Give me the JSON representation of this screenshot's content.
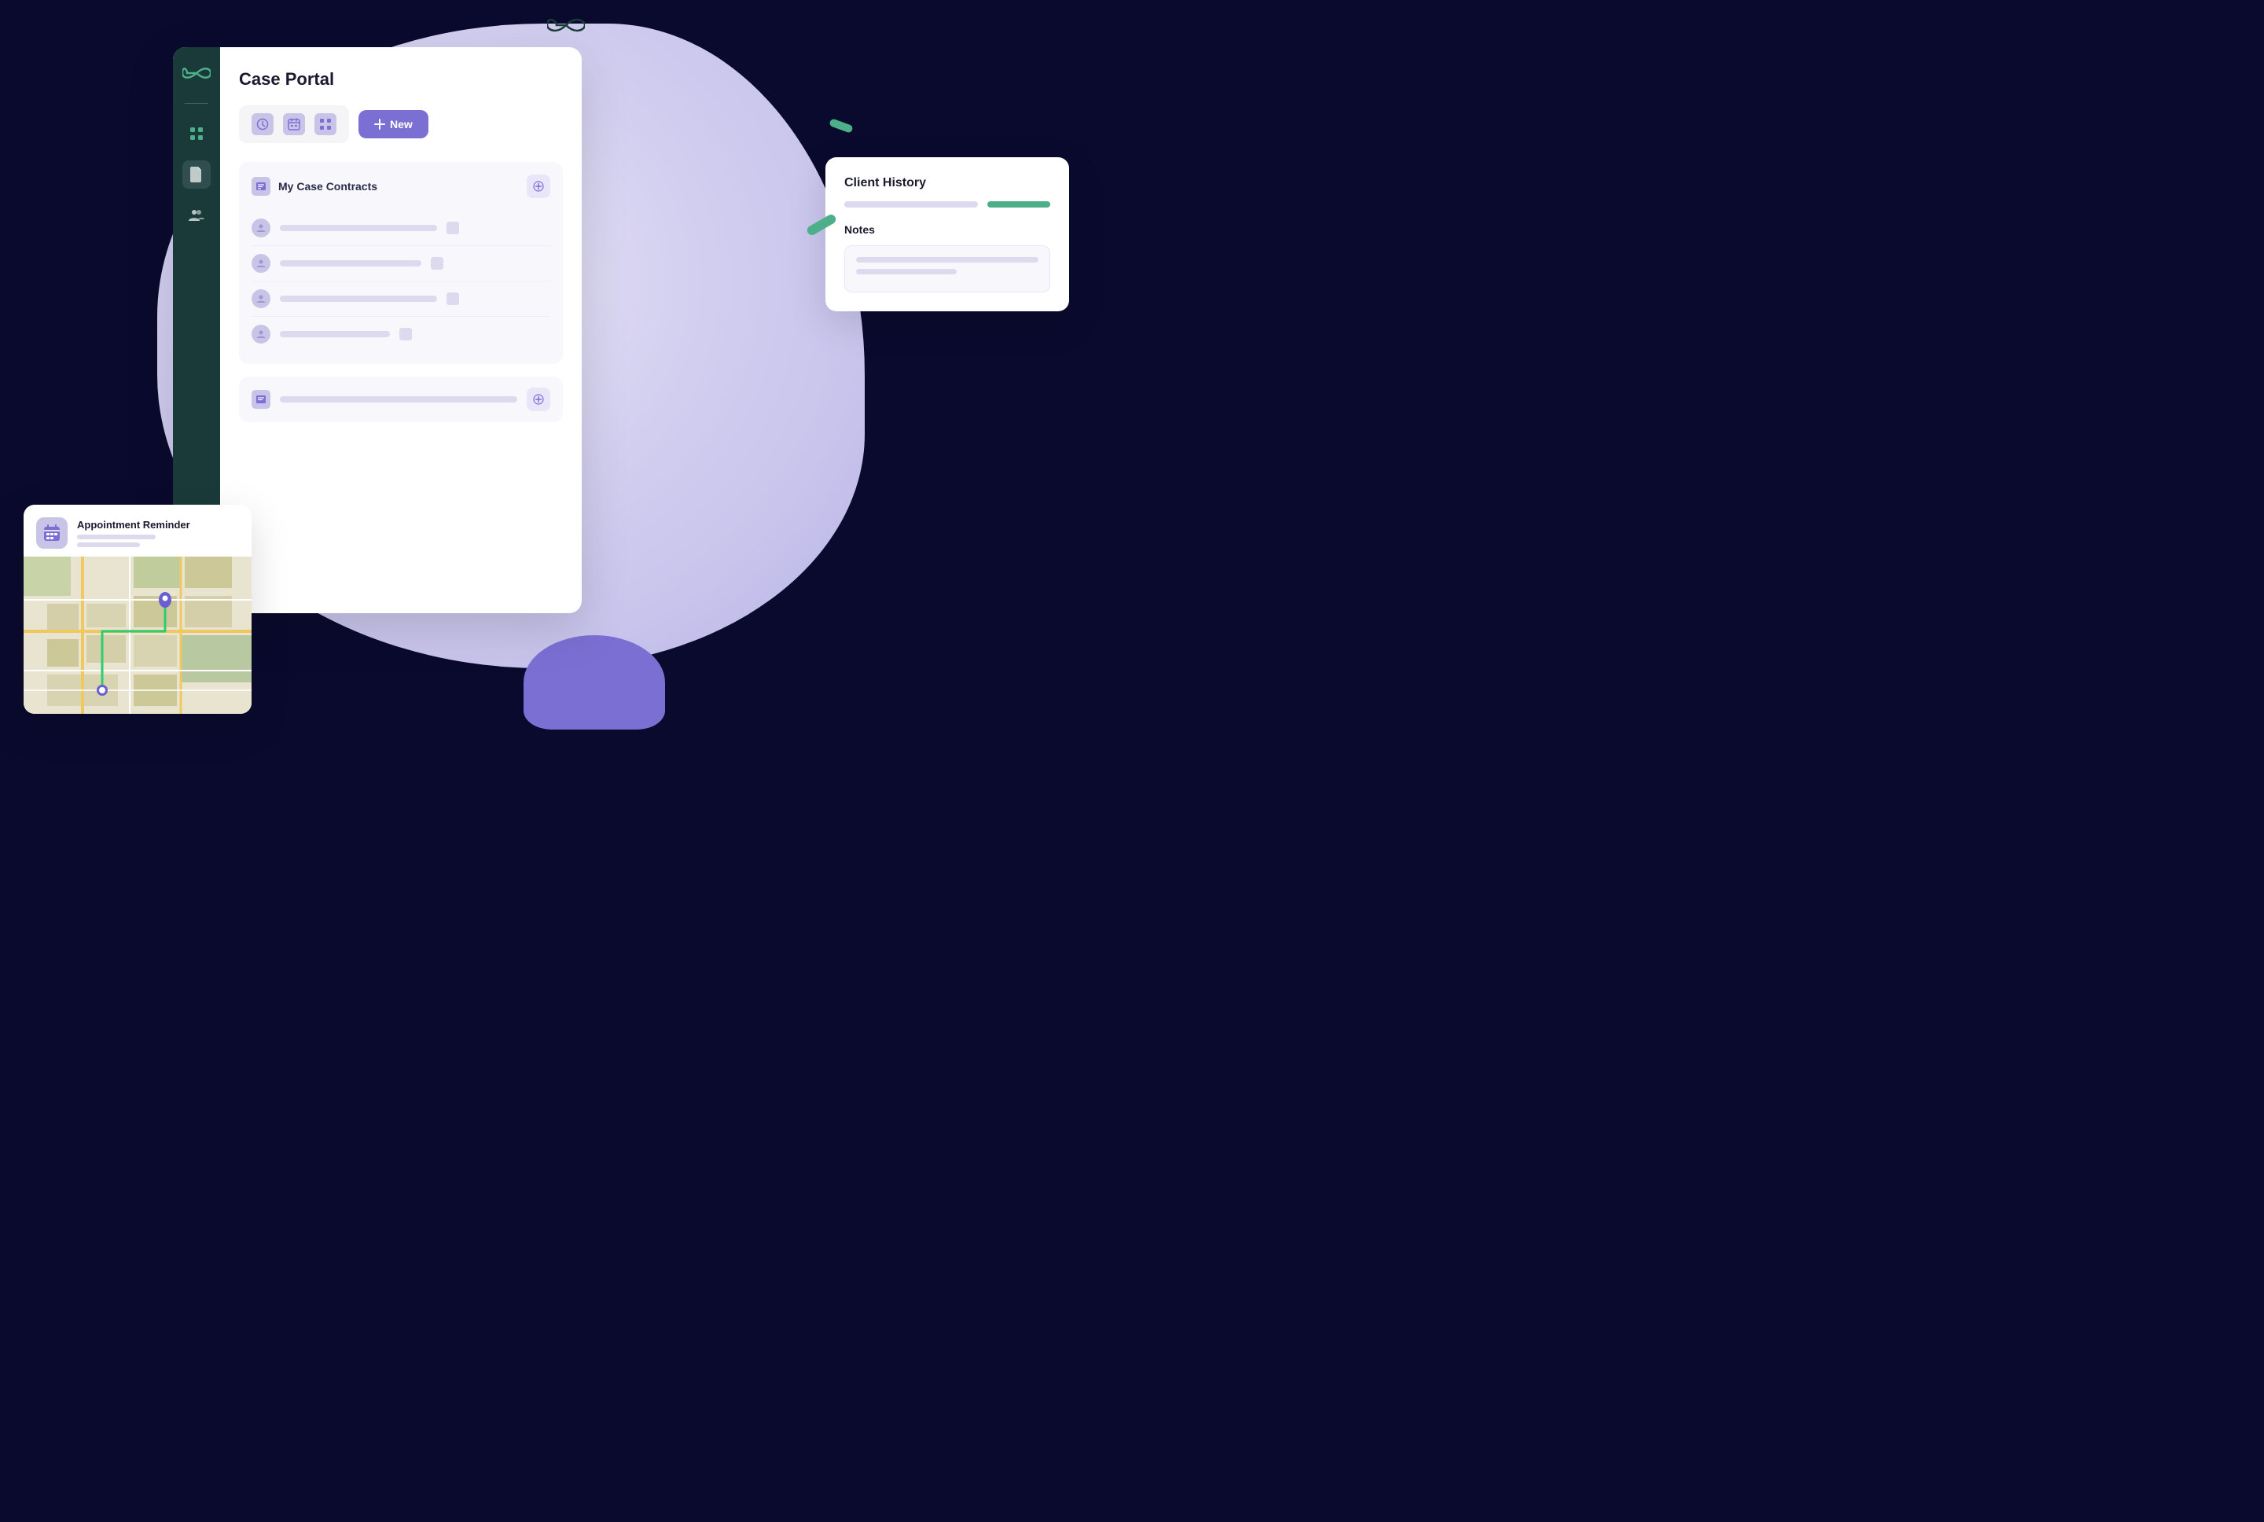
{
  "app": {
    "title": "Case Portal"
  },
  "sidebar": {
    "items": [
      {
        "label": "Dashboard",
        "icon": "grid-icon",
        "active": false
      },
      {
        "label": "Documents",
        "icon": "document-icon",
        "active": true
      },
      {
        "label": "People",
        "icon": "people-icon",
        "active": false
      }
    ]
  },
  "toolbar": {
    "icon1_label": "Clock",
    "icon2_label": "Calendar",
    "icon3_label": "Grid",
    "new_button_label": "New"
  },
  "case_contracts": {
    "title": "My Case Contracts",
    "items": [
      {
        "id": 1
      },
      {
        "id": 2
      },
      {
        "id": 3
      },
      {
        "id": 4
      }
    ]
  },
  "client_history": {
    "title": "Client History",
    "notes_title": "Notes",
    "notes_line1": "",
    "notes_line2": ""
  },
  "appointment": {
    "title": "Appointment Reminder",
    "subtitle_line1": "",
    "subtitle_line2": ""
  }
}
